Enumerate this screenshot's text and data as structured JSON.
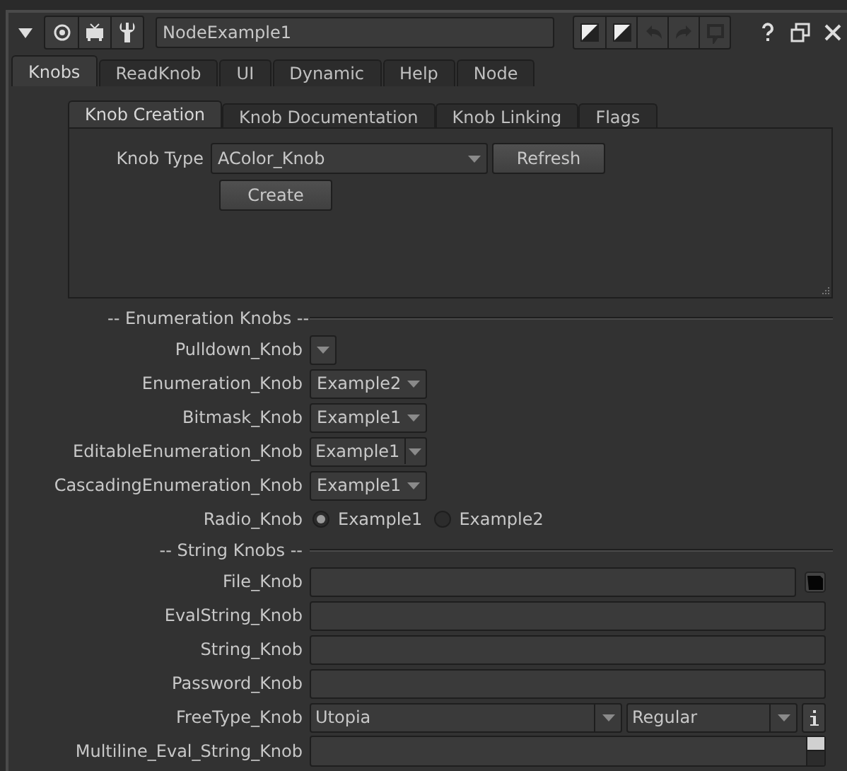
{
  "header": {
    "title": "NodeExample1",
    "collapsed": false
  },
  "tabs": [
    {
      "label": "Knobs",
      "selected": true
    },
    {
      "label": "ReadKnob",
      "selected": false
    },
    {
      "label": "UI",
      "selected": false
    },
    {
      "label": "Dynamic",
      "selected": false
    },
    {
      "label": "Help",
      "selected": false
    },
    {
      "label": "Node",
      "selected": false
    }
  ],
  "subtabs": [
    {
      "label": "Knob Creation",
      "selected": true
    },
    {
      "label": "Knob Documentation",
      "selected": false
    },
    {
      "label": "Knob Linking",
      "selected": false
    },
    {
      "label": "Flags",
      "selected": false
    }
  ],
  "knob_type": {
    "label": "Knob Type",
    "value": "AColor_Knob"
  },
  "buttons": {
    "refresh": "Refresh",
    "create": "Create"
  },
  "sections": [
    {
      "heading": "-- Enumeration Knobs --",
      "rows": [
        {
          "kind": "pulldown",
          "label": "Pulldown_Knob"
        },
        {
          "kind": "enum",
          "label": "Enumeration_Knob",
          "value": "Example2"
        },
        {
          "kind": "enum",
          "label": "Bitmask_Knob",
          "value": "Example1"
        },
        {
          "kind": "editable_enum",
          "label": "EditableEnumeration_Knob",
          "value": "Example1"
        },
        {
          "kind": "enum",
          "label": "CascadingEnumeration_Knob",
          "value": "Example1"
        },
        {
          "kind": "radio",
          "label": "Radio_Knob",
          "options": [
            {
              "label": "Example1",
              "selected": true
            },
            {
              "label": "Example2",
              "selected": false
            }
          ]
        }
      ]
    },
    {
      "heading": "-- String Knobs --",
      "rows": [
        {
          "kind": "file",
          "label": "File_Knob"
        },
        {
          "kind": "string",
          "label": "EvalString_Knob"
        },
        {
          "kind": "string",
          "label": "String_Knob"
        },
        {
          "kind": "string",
          "label": "Password_Knob"
        },
        {
          "kind": "freetype",
          "label": "FreeType_Knob",
          "value": "Utopia",
          "style": "Regular"
        },
        {
          "kind": "multiline",
          "label": "Multiline_Eval_String_Knob"
        }
      ]
    }
  ]
}
